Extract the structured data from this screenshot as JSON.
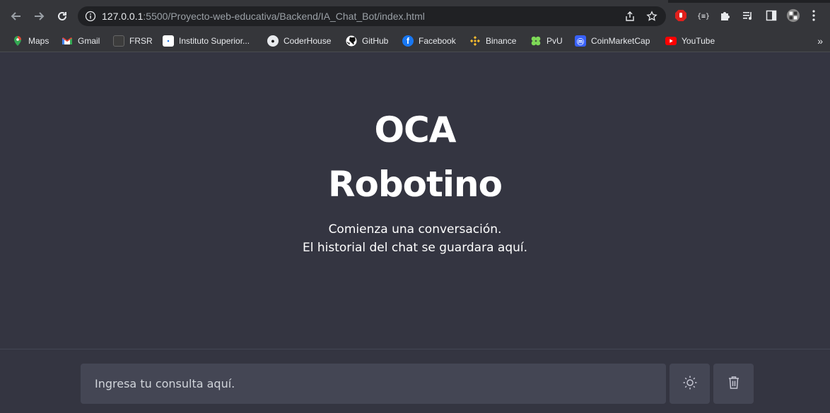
{
  "browser": {
    "url_host": "127.0.0.1",
    "url_path": ":5500/Proyecto-web-educativa/Backend/IA_Chat_Bot/index.html",
    "bookmarks": [
      {
        "label": "Maps"
      },
      {
        "label": "Gmail"
      },
      {
        "label": "FRSR"
      },
      {
        "label": "Instituto Superior..."
      },
      {
        "label": "CoderHouse"
      },
      {
        "label": "GitHub"
      },
      {
        "label": "Facebook"
      },
      {
        "label": "Binance"
      },
      {
        "label": "PvU"
      },
      {
        "label": "CoinMarketCap"
      },
      {
        "label": "YouTube"
      }
    ],
    "more": "»"
  },
  "page": {
    "title_line1": "OCA",
    "title_line2": "Robotino",
    "subtitle_line1": "Comienza una conversación.",
    "subtitle_line2": "El historial del chat se guardara aquí.",
    "input_placeholder": "Ingresa tu consulta aquí."
  },
  "colors": {
    "background": "#343541",
    "input_bg": "#444654",
    "chrome": "#35363a"
  }
}
